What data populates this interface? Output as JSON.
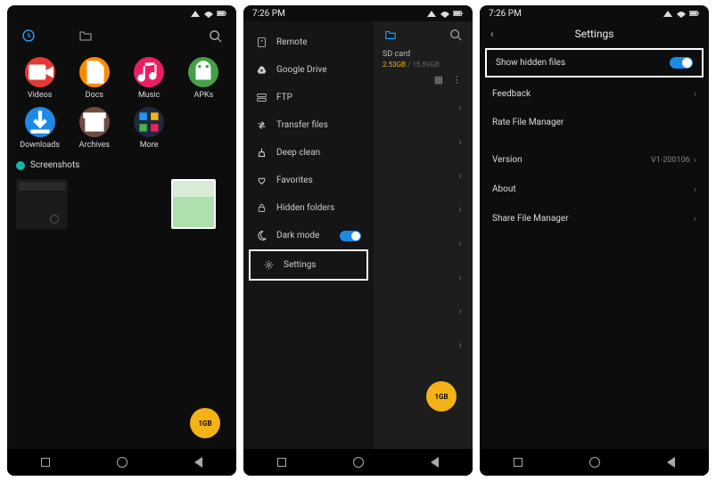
{
  "status": {
    "time": "7:26 PM"
  },
  "screen1": {
    "categories": [
      {
        "label": "Videos",
        "color": "#e53935",
        "icon": "video"
      },
      {
        "label": "Docs",
        "color": "#fb8c00",
        "icon": "doc"
      },
      {
        "label": "Music",
        "color": "#e91e63",
        "icon": "music"
      },
      {
        "label": "APKs",
        "color": "#43a047",
        "icon": "apk"
      },
      {
        "label": "Downloads",
        "color": "#1e88e5",
        "icon": "download"
      },
      {
        "label": "Archives",
        "color": "#6d4c41",
        "icon": "archive"
      },
      {
        "label": "More",
        "color": "#1e293b",
        "icon": "more"
      }
    ],
    "section": "Screenshots",
    "fab": "1GB"
  },
  "screen2": {
    "drawer": [
      {
        "label": "Remote",
        "icon": "remote"
      },
      {
        "label": "Google Drive",
        "icon": "gdrive"
      },
      {
        "label": "FTP",
        "icon": "ftp"
      },
      {
        "label": "Transfer files",
        "icon": "transfer"
      },
      {
        "label": "Deep clean",
        "icon": "clean"
      },
      {
        "label": "Favorites",
        "icon": "heart"
      },
      {
        "label": "Hidden folders",
        "icon": "lock"
      },
      {
        "label": "Dark mode",
        "icon": "moon",
        "toggle": true
      },
      {
        "label": "Settings",
        "icon": "gear",
        "highlight": true
      }
    ],
    "crumb": "SD card",
    "used": "2.53GB",
    "total": "15.89GB",
    "fab": "1GB"
  },
  "screen3": {
    "title": "Settings",
    "rows": {
      "hidden": "Show hidden files",
      "feedback": "Feedback",
      "rate": "Rate File Manager",
      "version": "Version",
      "version_val": "V1-200106",
      "about": "About",
      "share": "Share File Manager"
    }
  }
}
